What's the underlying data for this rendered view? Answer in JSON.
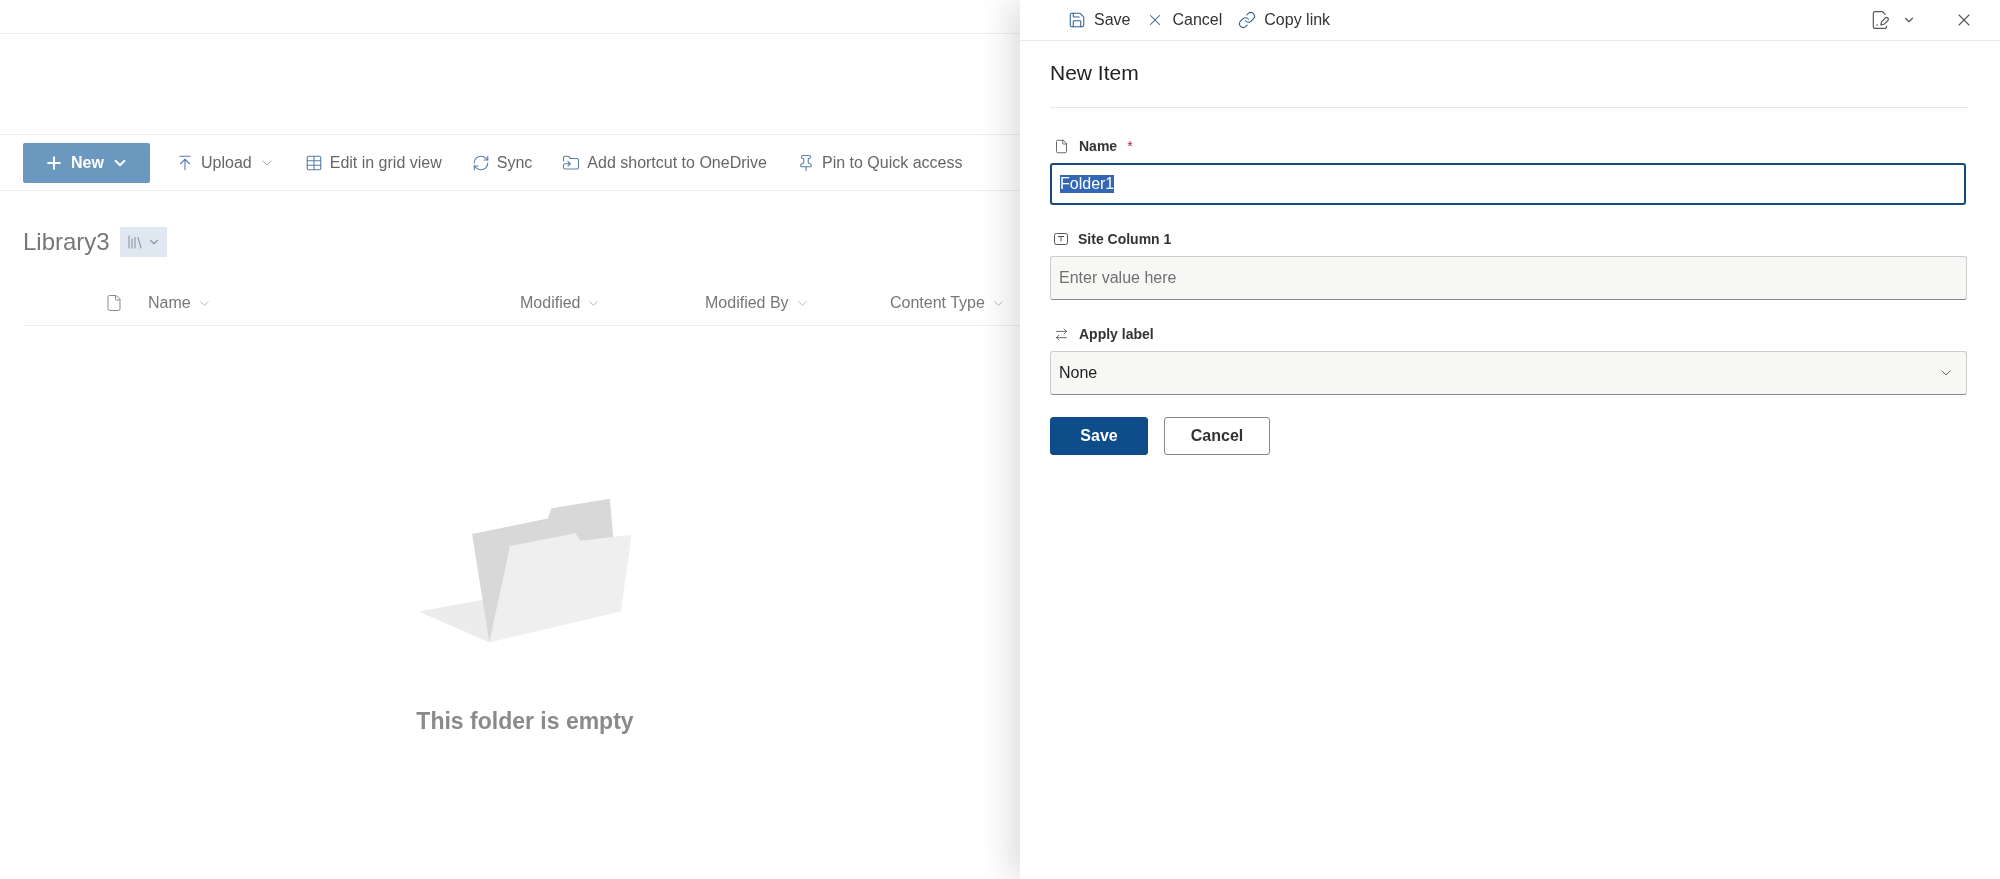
{
  "toolbar": [
    {
      "kind": "new",
      "label": "New",
      "primary": true,
      "dropdown": true
    },
    {
      "kind": "upload",
      "label": "Upload",
      "primary": false,
      "dropdown": true
    },
    {
      "kind": "grid",
      "label": "Edit in grid view",
      "primary": false,
      "dropdown": false
    },
    {
      "kind": "sync",
      "label": "Sync",
      "primary": false,
      "dropdown": false
    },
    {
      "kind": "shortcut",
      "label": "Add shortcut to OneDrive",
      "primary": false,
      "dropdown": false
    },
    {
      "kind": "pin",
      "label": "Pin to Quick access",
      "primary": false,
      "dropdown": false
    }
  ],
  "library": {
    "title": "Library3"
  },
  "columns": [
    {
      "kind": "icon"
    },
    {
      "kind": "text",
      "label": "Name"
    },
    {
      "kind": "text",
      "label": "Modified"
    },
    {
      "kind": "text",
      "label": "Modified By"
    },
    {
      "kind": "text",
      "label": "Content Type"
    }
  ],
  "empty_message": "This folder is empty",
  "panel": {
    "commands": [
      {
        "kind": "save",
        "label": "Save"
      },
      {
        "kind": "cancel",
        "label": "Cancel"
      },
      {
        "kind": "link",
        "label": "Copy link"
      }
    ],
    "title": "New Item",
    "fields": [
      {
        "kind": "text",
        "label": "Name",
        "required_mark": "*",
        "value": "Folder1",
        "focused": true,
        "text_selected": true
      },
      {
        "kind": "text",
        "label": "Site Column 1",
        "placeholder": "Enter value here",
        "focused": false
      },
      {
        "kind": "dropdown",
        "label": "Apply label",
        "value": "None",
        "focused": false
      }
    ],
    "buttons": [
      {
        "label": "Save",
        "primary": true
      },
      {
        "label": "Cancel",
        "primary": false
      }
    ]
  }
}
